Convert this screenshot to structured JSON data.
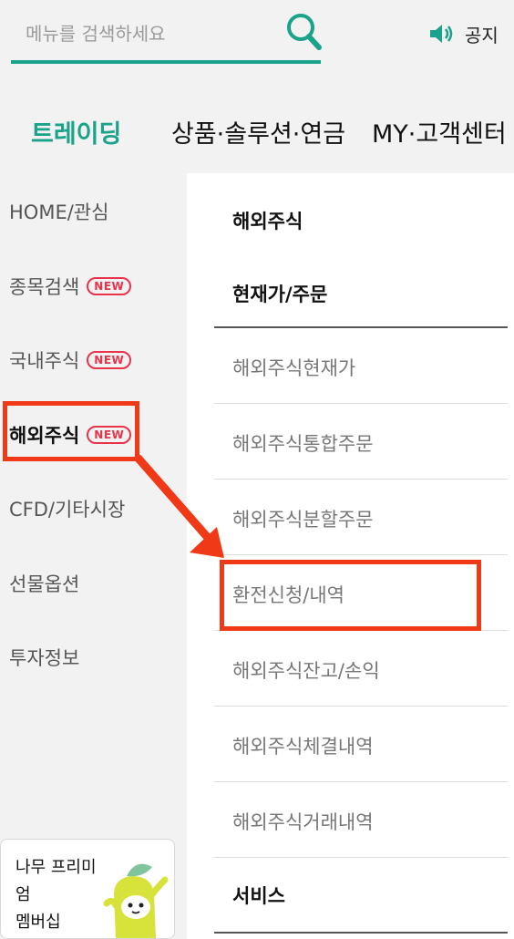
{
  "search": {
    "placeholder": "메뉴를 검색하세요",
    "value": ""
  },
  "header": {
    "notice_label": "공지"
  },
  "tabs": [
    {
      "label": "트레이딩",
      "active": true
    },
    {
      "label": "상품·솔루션·연금",
      "active": false
    },
    {
      "label": "MY·고객센터",
      "active": false
    }
  ],
  "sidebar": {
    "items": [
      {
        "label": "HOME/관심",
        "badge": ""
      },
      {
        "label": "종목검색",
        "badge": "NEW"
      },
      {
        "label": "국내주식",
        "badge": "NEW"
      },
      {
        "label": "해외주식",
        "badge": "NEW",
        "active": true
      },
      {
        "label": "CFD/기타시장",
        "badge": ""
      },
      {
        "label": "선물옵션",
        "badge": ""
      },
      {
        "label": "투자정보",
        "badge": ""
      }
    ],
    "promo": {
      "line1": "나무 프리미엄",
      "line2": "멤버십"
    }
  },
  "submenu": {
    "section_title": "해외주식",
    "group_title": "현재가/주문",
    "items": [
      "해외주식현재가",
      "해외주식통합주문",
      "해외주식분할주문",
      "환전신청/내역",
      "해외주식잔고/손익",
      "해외주식체결내역",
      "해외주식거래내역"
    ],
    "footer_title": "서비스"
  },
  "colors": {
    "accent": "#1aa28a",
    "badge": "#e8334a",
    "highlight": "#f03a17"
  }
}
